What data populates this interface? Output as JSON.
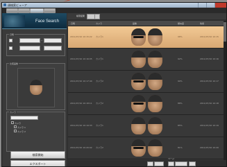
{
  "window": {
    "title": "顔検索ビューア"
  },
  "header": {
    "title": "Face Search"
  },
  "accent": "#b8432c",
  "search_panel": {
    "date_label": "日時",
    "from_date": "2011/07/10",
    "to_date": "2011/07/10",
    "checkbox_label": "日付"
  },
  "face_panel": {
    "label": "比較画像"
  },
  "camera_panel": {
    "label": "カメラ",
    "dropdown_value": "",
    "tree": [
      "カメラ",
      "カメラ 1",
      "カメラ 2"
    ]
  },
  "buttons": {
    "search": "検索開始",
    "export": "エクスポート"
  },
  "results": {
    "tab_label": "検索結果",
    "columns": [
      "日時",
      "カメラ",
      "画像",
      "",
      "類似度",
      "情報"
    ],
    "rows": [
      {
        "time": "2011/07/10 10:15:22",
        "camera": "カメラ1",
        "score": "98%",
        "info": "2011/07/10 10:15"
      },
      {
        "time": "2011/07/10 10:16:05",
        "camera": "カメラ1",
        "score": "92%",
        "info": "2011/07/10 10:16"
      },
      {
        "time": "2011/07/10 10:17:40",
        "camera": "カメラ2",
        "score": "90%",
        "info": "2011/07/10 10:17"
      },
      {
        "time": "2011/07/10 10:18:11",
        "camera": "カメラ2",
        "score": "88%",
        "info": "2011/07/10 10:18"
      },
      {
        "time": "2011/07/10 10:19:33",
        "camera": "カメラ1",
        "score": "85%",
        "info": "2011/07/10 10:19"
      },
      {
        "time": "2011/07/10 10:20:02",
        "camera": "カメラ2",
        "score": "81%",
        "info": "2011/07/10 10:20"
      }
    ]
  },
  "pager": {
    "label": "ページ",
    "page": "1",
    "total": "1"
  }
}
